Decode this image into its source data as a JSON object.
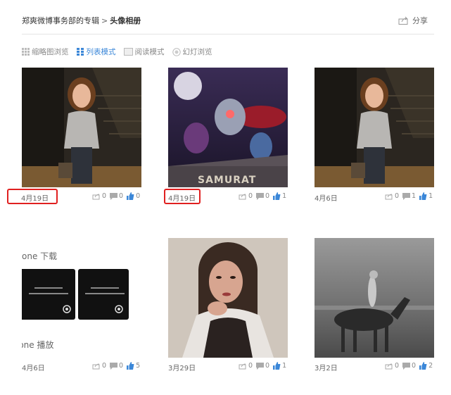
{
  "breadcrumb": {
    "owner": "郑爽微博事务部的专辑",
    "separator": ">",
    "current": "头像相册"
  },
  "share_label": "分享",
  "view_modes": [
    {
      "label": "缩略图浏览",
      "active": false,
      "icon": "grid-icon"
    },
    {
      "label": "列表模式",
      "active": true,
      "icon": "list-icon"
    },
    {
      "label": "阅读模式",
      "active": false,
      "icon": "book-icon"
    },
    {
      "label": "幻灯浏览",
      "active": false,
      "icon": "slideshow-icon"
    }
  ],
  "photos": [
    {
      "date": "4月19日",
      "forward": "0",
      "comment": "0",
      "like": "0",
      "highlighted": true
    },
    {
      "date": "4月19日",
      "forward": "0",
      "comment": "0",
      "like": "1",
      "highlighted": true,
      "caption": "SAMURAT"
    },
    {
      "date": "4月6日",
      "forward": "0",
      "comment": "1",
      "like": "1",
      "highlighted": false
    },
    {
      "date": "4月6日",
      "forward": "0",
      "comment": "0",
      "like": "5",
      "highlighted": false,
      "text_top": "one 下载",
      "text_bottom": "ione 播放"
    },
    {
      "date": "3月29日",
      "forward": "0",
      "comment": "0",
      "like": "1",
      "highlighted": false
    },
    {
      "date": "3月2日",
      "forward": "0",
      "comment": "0",
      "like": "2",
      "highlighted": false
    }
  ],
  "colors": {
    "accent": "#3b87d8",
    "highlight": "#e02020",
    "like": "#3b87d8"
  }
}
